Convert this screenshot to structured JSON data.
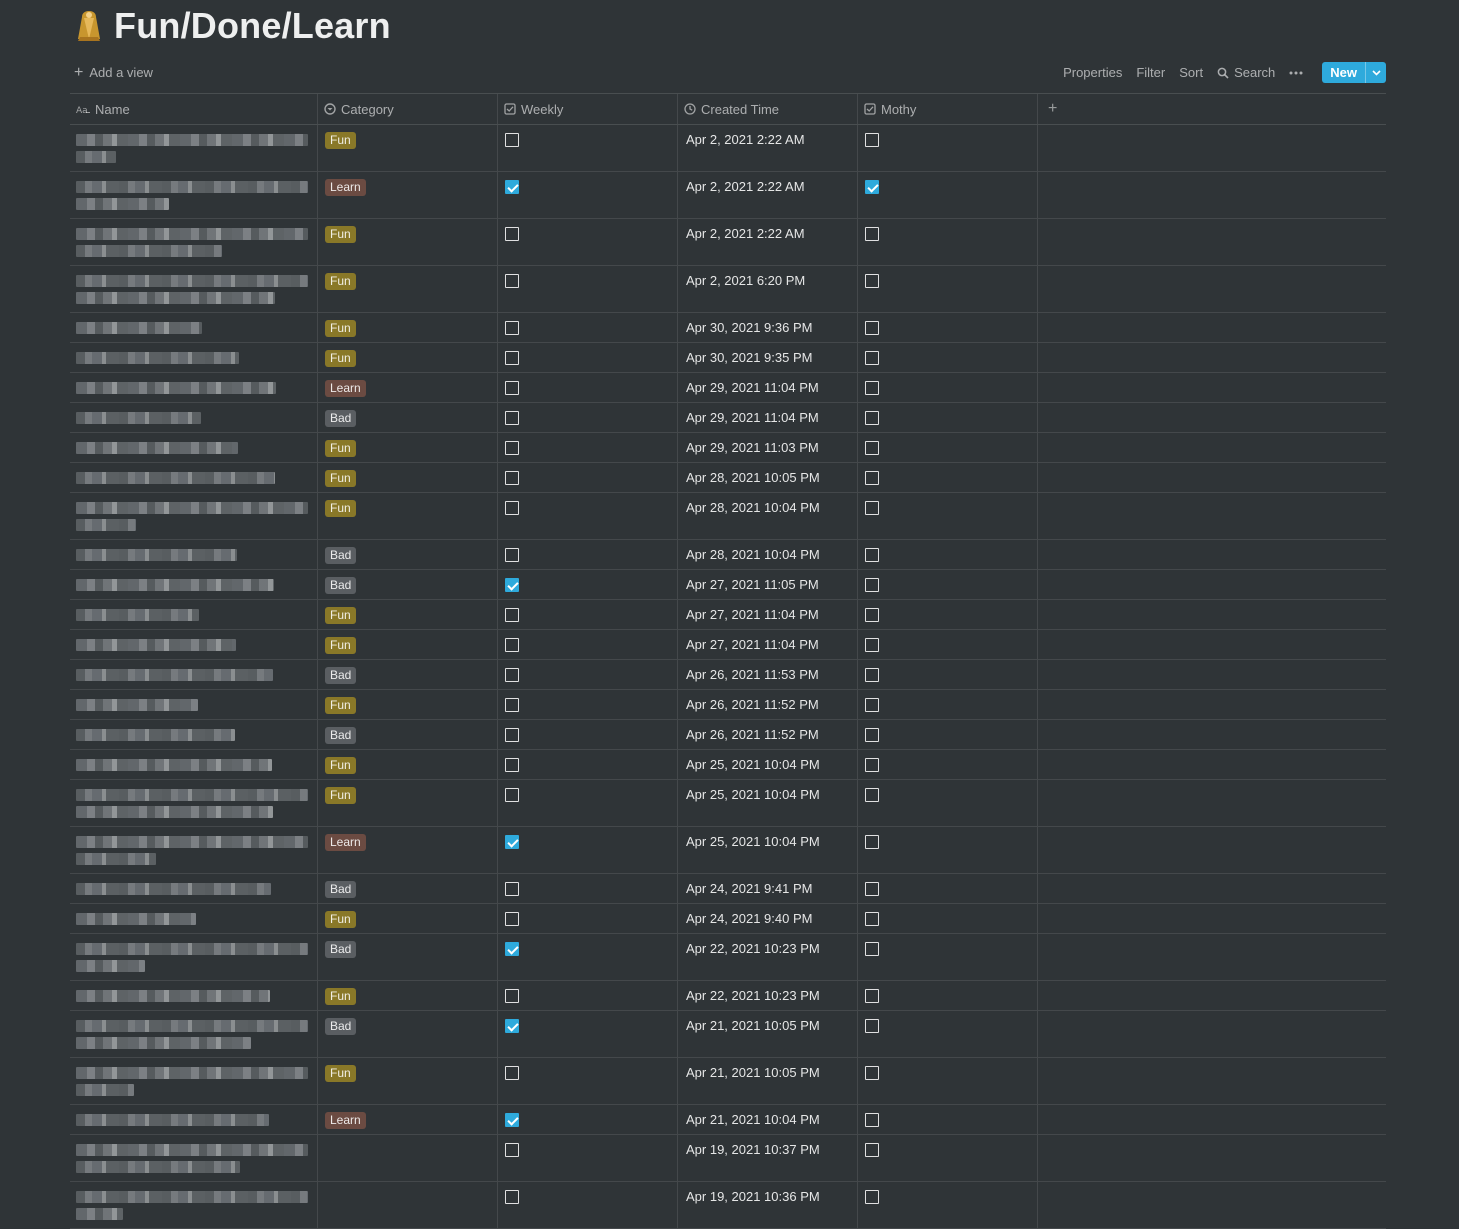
{
  "page": {
    "title": "Fun/Done/Learn",
    "icon": "cloak-emoji-icon"
  },
  "view_bar": {
    "add_view": "Add a view",
    "properties": "Properties",
    "filter": "Filter",
    "sort": "Sort",
    "search": "Search",
    "new": "New"
  },
  "columns": {
    "name": "Name",
    "category": "Category",
    "weekly": "Weekly",
    "created_time": "Created Time",
    "mothy": "Mothy"
  },
  "rows": [
    {
      "category": "Fun",
      "weekly": false,
      "created": "Apr 2, 2021 2:22 AM",
      "mothy": false,
      "lines": 2
    },
    {
      "category": "Learn",
      "weekly": true,
      "created": "Apr 2, 2021 2:22 AM",
      "mothy": true,
      "lines": 2
    },
    {
      "category": "Fun",
      "weekly": false,
      "created": "Apr 2, 2021 2:22 AM",
      "mothy": false,
      "lines": 2
    },
    {
      "category": "Fun",
      "weekly": false,
      "created": "Apr 2, 2021 6:20 PM",
      "mothy": false,
      "lines": 2
    },
    {
      "category": "Fun",
      "weekly": false,
      "created": "Apr 30, 2021 9:36 PM",
      "mothy": false,
      "lines": 1
    },
    {
      "category": "Fun",
      "weekly": false,
      "created": "Apr 30, 2021 9:35 PM",
      "mothy": false,
      "lines": 1
    },
    {
      "category": "Learn",
      "weekly": false,
      "created": "Apr 29, 2021 11:04 PM",
      "mothy": false,
      "lines": 1
    },
    {
      "category": "Bad",
      "weekly": false,
      "created": "Apr 29, 2021 11:04 PM",
      "mothy": false,
      "lines": 1
    },
    {
      "category": "Fun",
      "weekly": false,
      "created": "Apr 29, 2021 11:03 PM",
      "mothy": false,
      "lines": 1
    },
    {
      "category": "Fun",
      "weekly": false,
      "created": "Apr 28, 2021 10:05 PM",
      "mothy": false,
      "lines": 1
    },
    {
      "category": "Fun",
      "weekly": false,
      "created": "Apr 28, 2021 10:04 PM",
      "mothy": false,
      "lines": 2
    },
    {
      "category": "Bad",
      "weekly": false,
      "created": "Apr 28, 2021 10:04 PM",
      "mothy": false,
      "lines": 1
    },
    {
      "category": "Bad",
      "weekly": true,
      "created": "Apr 27, 2021 11:05 PM",
      "mothy": false,
      "lines": 1
    },
    {
      "category": "Fun",
      "weekly": false,
      "created": "Apr 27, 2021 11:04 PM",
      "mothy": false,
      "lines": 1
    },
    {
      "category": "Fun",
      "weekly": false,
      "created": "Apr 27, 2021 11:04 PM",
      "mothy": false,
      "lines": 1
    },
    {
      "category": "Bad",
      "weekly": false,
      "created": "Apr 26, 2021 11:53 PM",
      "mothy": false,
      "lines": 1
    },
    {
      "category": "Fun",
      "weekly": false,
      "created": "Apr 26, 2021 11:52 PM",
      "mothy": false,
      "lines": 1
    },
    {
      "category": "Bad",
      "weekly": false,
      "created": "Apr 26, 2021 11:52 PM",
      "mothy": false,
      "lines": 1
    },
    {
      "category": "Fun",
      "weekly": false,
      "created": "Apr 25, 2021 10:04 PM",
      "mothy": false,
      "lines": 1
    },
    {
      "category": "Fun",
      "weekly": false,
      "created": "Apr 25, 2021 10:04 PM",
      "mothy": false,
      "lines": 2
    },
    {
      "category": "Learn",
      "weekly": true,
      "created": "Apr 25, 2021 10:04 PM",
      "mothy": false,
      "lines": 2
    },
    {
      "category": "Bad",
      "weekly": false,
      "created": "Apr 24, 2021 9:41 PM",
      "mothy": false,
      "lines": 1
    },
    {
      "category": "Fun",
      "weekly": false,
      "created": "Apr 24, 2021 9:40 PM",
      "mothy": false,
      "lines": 1
    },
    {
      "category": "Bad",
      "weekly": true,
      "created": "Apr 22, 2021 10:23 PM",
      "mothy": false,
      "lines": 2
    },
    {
      "category": "Fun",
      "weekly": false,
      "created": "Apr 22, 2021 10:23 PM",
      "mothy": false,
      "lines": 1
    },
    {
      "category": "Bad",
      "weekly": true,
      "created": "Apr 21, 2021 10:05 PM",
      "mothy": false,
      "lines": 2
    },
    {
      "category": "Fun",
      "weekly": false,
      "created": "Apr 21, 2021 10:05 PM",
      "mothy": false,
      "lines": 2
    },
    {
      "category": "Learn",
      "weekly": true,
      "created": "Apr 21, 2021 10:04 PM",
      "mothy": false,
      "lines": 1
    },
    {
      "category": "",
      "weekly": false,
      "created": "Apr 19, 2021 10:37 PM",
      "mothy": false,
      "lines": 2
    },
    {
      "category": "",
      "weekly": false,
      "created": "Apr 19, 2021 10:36 PM",
      "mothy": false,
      "lines": 2
    }
  ],
  "colors": {
    "background": "#2f3437",
    "accent": "#2eaadc",
    "tag_fun": "#89782a",
    "tag_learn": "#6b4b42",
    "tag_bad": "#5a5e62"
  }
}
